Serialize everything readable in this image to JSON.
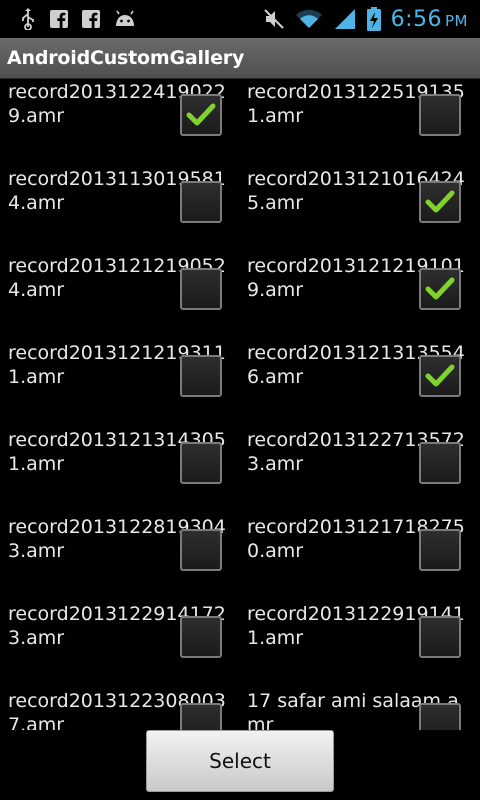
{
  "status_bar": {
    "time": "6:56",
    "ampm": "PM",
    "left_icons": [
      "usb-icon",
      "facebook-icon",
      "facebook-icon",
      "android-debug-icon"
    ],
    "right_icons": [
      "mute-icon",
      "wifi-icon",
      "signal-icon",
      "battery-charging-icon"
    ],
    "accent_color": "#4fb3e6"
  },
  "app": {
    "title": "AndroidCustomGallery"
  },
  "items": [
    {
      "name": "record20131224190229.amr",
      "checked": true
    },
    {
      "name": "record20131225191351.amr",
      "checked": false
    },
    {
      "name": "record20131130195814.amr",
      "checked": false
    },
    {
      "name": "record20131210164245.amr",
      "checked": true
    },
    {
      "name": "record20131212190524.amr",
      "checked": false
    },
    {
      "name": "record20131212191019.amr",
      "checked": true
    },
    {
      "name": "record20131212193111.amr",
      "checked": false
    },
    {
      "name": "record20131213135546.amr",
      "checked": true
    },
    {
      "name": "record20131213143051.amr",
      "checked": false
    },
    {
      "name": "record20131227135723.amr",
      "checked": false
    },
    {
      "name": "record20131228193043.amr",
      "checked": false
    },
    {
      "name": "record20131217182750.amr",
      "checked": false
    },
    {
      "name": "record20131229141723.amr",
      "checked": false
    },
    {
      "name": "record20131229191411.amr",
      "checked": false
    },
    {
      "name": "record20131223080037.amr",
      "checked": false
    },
    {
      "name": "17 safar ami salaam.amr",
      "checked": false
    }
  ],
  "footer": {
    "select_label": "Select"
  },
  "colors": {
    "check_mark": "#7fd32a",
    "title_bar": "#5c5c5c"
  }
}
